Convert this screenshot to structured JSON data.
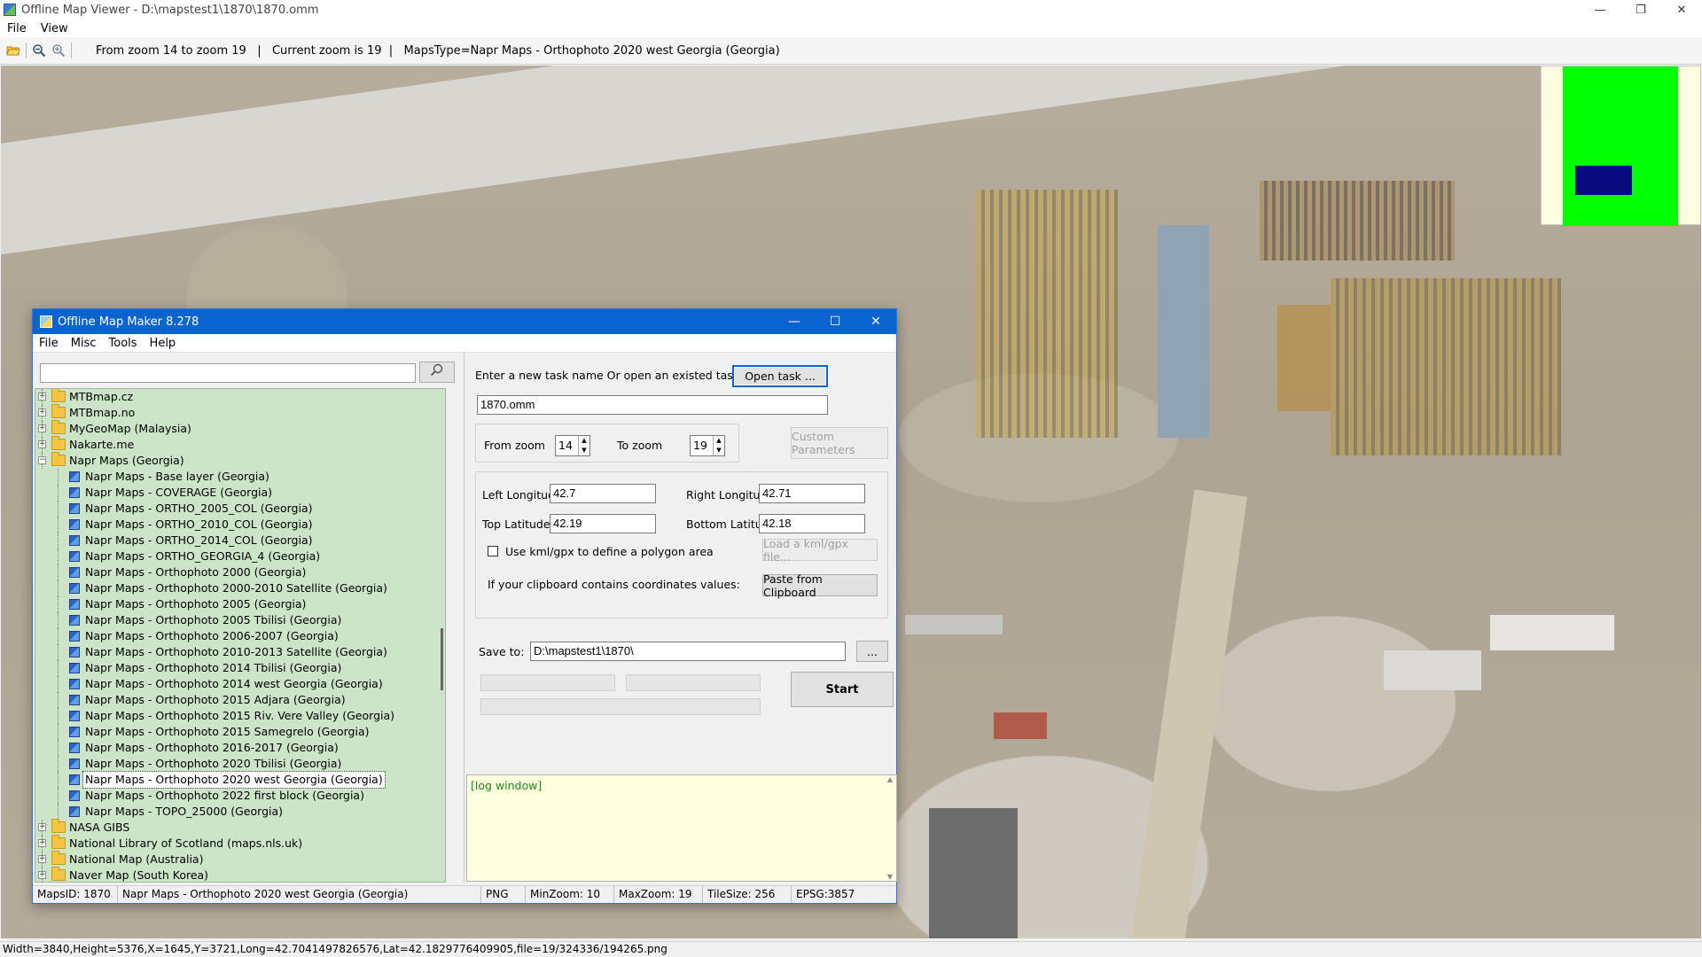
{
  "viewer": {
    "title": "Offline Map Viewer - D:\\mapstest1\\1870\\1870.omm",
    "menu": [
      "File",
      "View"
    ],
    "toolbar_info": "From zoom 14 to zoom 19   |   Current zoom is 19  |   MapsType=Napr Maps - Orthophoto 2020 west Georgia (Georgia)",
    "status": "Width=3840,Height=5376,X=1645,Y=3721,Long=42.7041497826576,Lat=42.1829776409905,file=19/324336/194265.png",
    "window_buttons": {
      "minimize": "—",
      "maximize": "❐",
      "close": "✕"
    }
  },
  "dialog": {
    "title": "Offline Map Maker 8.278",
    "menu": [
      "File",
      "Misc",
      "Tools",
      "Help"
    ],
    "window_buttons": {
      "minimize": "—",
      "maximize": "☐",
      "close": "✕"
    },
    "search": {
      "value": "",
      "placeholder": ""
    },
    "tree": [
      {
        "label": "MTBmap.cz",
        "level": 0,
        "type": "folder",
        "expanded": false
      },
      {
        "label": "MTBmap.no",
        "level": 0,
        "type": "folder",
        "expanded": false
      },
      {
        "label": "MyGeoMap (Malaysia)",
        "level": 0,
        "type": "folder",
        "expanded": false
      },
      {
        "label": "Nakarte.me",
        "level": 0,
        "type": "folder",
        "expanded": false
      },
      {
        "label": "Napr Maps (Georgia)",
        "level": 0,
        "type": "folder",
        "expanded": true
      },
      {
        "label": "Napr Maps - Base layer (Georgia)",
        "level": 1,
        "type": "map"
      },
      {
        "label": "Napr Maps - COVERAGE (Georgia)",
        "level": 1,
        "type": "map"
      },
      {
        "label": "Napr Maps - ORTHO_2005_COL (Georgia)",
        "level": 1,
        "type": "map"
      },
      {
        "label": "Napr Maps - ORTHO_2010_COL (Georgia)",
        "level": 1,
        "type": "map"
      },
      {
        "label": "Napr Maps - ORTHO_2014_COL (Georgia)",
        "level": 1,
        "type": "map"
      },
      {
        "label": "Napr Maps - ORTHO_GEORGIA_4 (Georgia)",
        "level": 1,
        "type": "map"
      },
      {
        "label": "Napr Maps - Orthophoto 2000 (Georgia)",
        "level": 1,
        "type": "map"
      },
      {
        "label": "Napr Maps - Orthophoto 2000-2010 Satellite (Georgia)",
        "level": 1,
        "type": "map"
      },
      {
        "label": "Napr Maps - Orthophoto 2005 (Georgia)",
        "level": 1,
        "type": "map"
      },
      {
        "label": "Napr Maps - Orthophoto 2005 Tbilisi (Georgia)",
        "level": 1,
        "type": "map"
      },
      {
        "label": "Napr Maps - Orthophoto 2006-2007 (Georgia)",
        "level": 1,
        "type": "map"
      },
      {
        "label": "Napr Maps - Orthophoto 2010-2013 Satellite (Georgia)",
        "level": 1,
        "type": "map"
      },
      {
        "label": "Napr Maps - Orthophoto 2014 Tbilisi (Georgia)",
        "level": 1,
        "type": "map"
      },
      {
        "label": "Napr Maps - Orthophoto 2014 west Georgia (Georgia)",
        "level": 1,
        "type": "map"
      },
      {
        "label": "Napr Maps - Orthophoto 2015 Adjara (Georgia)",
        "level": 1,
        "type": "map"
      },
      {
        "label": "Napr Maps - Orthophoto 2015 Riv. Vere Valley (Georgia)",
        "level": 1,
        "type": "map"
      },
      {
        "label": "Napr Maps - Orthophoto 2015 Samegrelo (Georgia)",
        "level": 1,
        "type": "map"
      },
      {
        "label": "Napr Maps - Orthophoto 2016-2017 (Georgia)",
        "level": 1,
        "type": "map"
      },
      {
        "label": "Napr Maps - Orthophoto 2020 Tbilisi (Georgia)",
        "level": 1,
        "type": "map"
      },
      {
        "label": "Napr Maps - Orthophoto 2020 west Georgia (Georgia)",
        "level": 1,
        "type": "map",
        "selected": true
      },
      {
        "label": "Napr Maps - Orthophoto 2022 first block (Georgia)",
        "level": 1,
        "type": "map"
      },
      {
        "label": "Napr Maps - TOPO_25000 (Georgia)",
        "level": 1,
        "type": "map"
      },
      {
        "label": "NASA GIBS",
        "level": 0,
        "type": "folder",
        "expanded": false
      },
      {
        "label": "National Library of Scotland (maps.nls.uk)",
        "level": 0,
        "type": "folder",
        "expanded": false
      },
      {
        "label": "National Map (Australia)",
        "level": 0,
        "type": "folder",
        "expanded": false
      },
      {
        "label": "Naver Map (South Korea)",
        "level": 0,
        "type": "folder",
        "expanded": false
      }
    ],
    "task": {
      "prompt": "Enter a new task name Or open an existed task to continue:",
      "open_button": "Open task ...",
      "name": "1870.omm"
    },
    "zoom": {
      "from_label": "From zoom",
      "from_value": "14",
      "to_label": "To zoom",
      "to_value": "19",
      "custom_button": "Custom Parameters"
    },
    "bounds": {
      "left_label": "Left Longitude",
      "left_value": "42.7",
      "right_label": "Right Longitude",
      "right_value": "42.71",
      "top_label": "Top Latitude",
      "top_value": "42.19",
      "bottom_label": "Bottom Latitude",
      "bottom_value": "42.18",
      "kml_checkbox_label": "Use kml/gpx to define a polygon area",
      "kml_checked": false,
      "load_kml_button": "Load a kml/gpx file...",
      "clipboard_label": "If your clipboard contains coordinates values:",
      "paste_button": "Paste from Clipboard"
    },
    "save": {
      "label": "Save to:",
      "path": "D:\\mapstest1\\1870\\",
      "browse_button": "...",
      "start_button": "Start"
    },
    "log": {
      "text": "[log window]"
    },
    "status": {
      "maps_id": "MapsID: 1870",
      "map_name": "Napr Maps - Orthophoto 2020 west Georgia (Georgia)",
      "format": "PNG",
      "min_zoom": "MinZoom: 10",
      "max_zoom": "MaxZoom: 19",
      "tile_size": "TileSize: 256",
      "epsg": "EPSG:3857"
    }
  },
  "colors": {
    "dialog_title_bg": "#0a64d0",
    "tree_bg": "#cce5c8",
    "log_bg": "#ffffe0",
    "log_text": "#1a8a1a",
    "minimap_green": "#00ff00",
    "minimap_view": "#0a0a80"
  },
  "icons": {
    "open_folder": "folder-open-icon",
    "zoom_out": "zoom-out-icon",
    "zoom_in": "zoom-in-icon",
    "search": "magnifier-icon"
  }
}
